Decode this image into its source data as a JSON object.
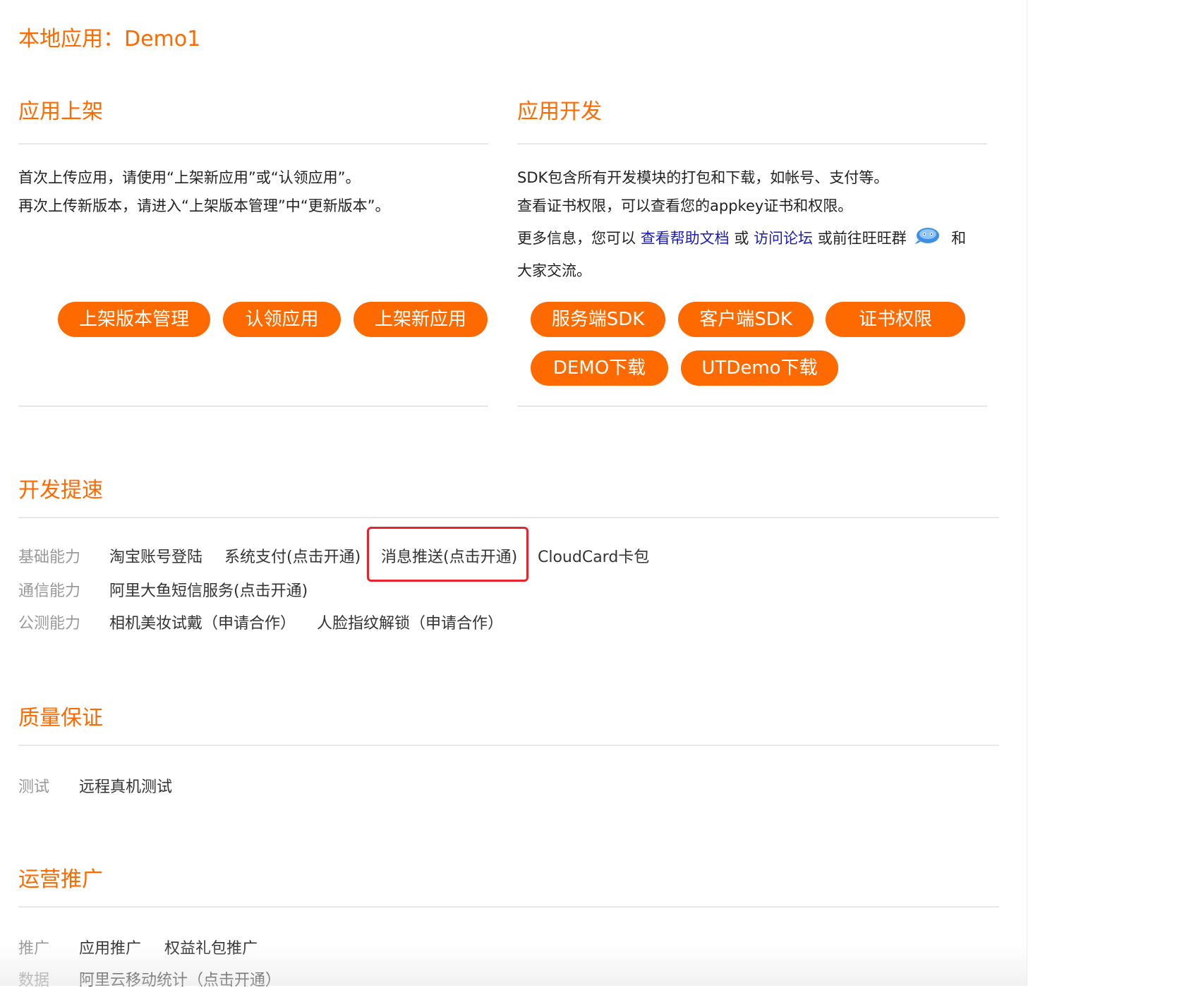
{
  "app_title": "本地应用：Demo1",
  "publish": {
    "title": "应用上架",
    "lines": [
      "首次上传应用，请使用“上架新应用”或“认领应用”。",
      "再次上传新版本，请进入“上架版本管理”中“更新版本”。"
    ],
    "buttons": [
      "上架版本管理",
      "认领应用",
      "上架新应用"
    ]
  },
  "develop": {
    "title": "应用开发",
    "line1": "SDK包含所有开发模块的打包和下载，如帐号、支付等。",
    "line2": "查看证书权限，可以查看您的appkey证书和权限。",
    "line3_prefix": "更多信息，您可以",
    "link_help": "查看帮助文档",
    "or": "或",
    "link_forum": "访问论坛",
    "line3_mid": "或前往旺旺群",
    "line3_suffix": "和",
    "line4": "大家交流。",
    "buttons": [
      "服务端SDK",
      "客户端SDK",
      "证书权限",
      "DEMO下载",
      "UTDemo下载"
    ]
  },
  "speedup": {
    "title": "开发提速",
    "rows": [
      {
        "label": "基础能力",
        "items": [
          "淘宝账号登陆",
          "系统支付(点击开通)",
          "消息推送(点击开通)",
          "CloudCard卡包"
        ]
      },
      {
        "label": "通信能力",
        "items": [
          "阿里大鱼短信服务(点击开通)"
        ]
      },
      {
        "label": "公测能力",
        "items": [
          "相机美妆试戴（申请合作）",
          "人脸指纹解锁（申请合作）"
        ]
      }
    ]
  },
  "quality": {
    "title": "质量保证",
    "rows": [
      {
        "label": "测试",
        "items": [
          "远程真机测试"
        ]
      }
    ]
  },
  "operations": {
    "title": "运营推广",
    "rows": [
      {
        "label": "推广",
        "items": [
          "应用推广",
          "权益礼包推广"
        ]
      },
      {
        "label": "数据",
        "items": [
          "阿里云移动统计（点击开通）"
        ]
      }
    ]
  },
  "colors": {
    "accent": "#ff6a00",
    "link": "#1a1ab8",
    "highlight": "#e8232b",
    "label": "#999999"
  },
  "icons": {
    "wangwang": "wangwang-icon"
  }
}
